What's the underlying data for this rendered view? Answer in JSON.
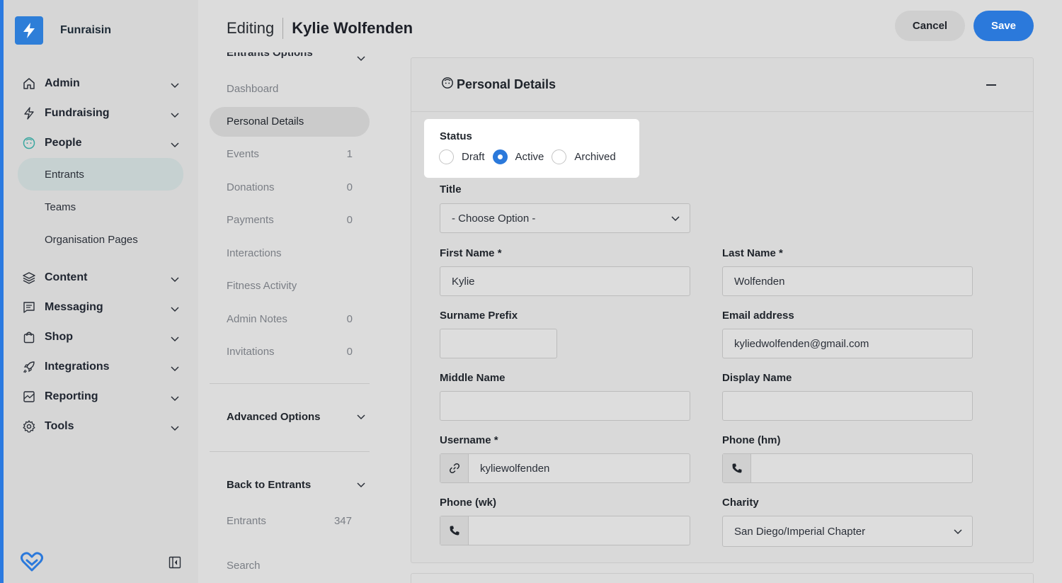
{
  "brand": {
    "name": "Funraisin"
  },
  "nav": {
    "items": [
      {
        "label": "Admin",
        "icon": "home-icon"
      },
      {
        "label": "Fundraising",
        "icon": "bolt-icon"
      },
      {
        "label": "People",
        "icon": "face-icon"
      },
      {
        "label": "Content",
        "icon": "layers-icon"
      },
      {
        "label": "Messaging",
        "icon": "message-icon"
      },
      {
        "label": "Shop",
        "icon": "bag-icon"
      },
      {
        "label": "Integrations",
        "icon": "rocket-icon"
      },
      {
        "label": "Reporting",
        "icon": "chart-icon"
      },
      {
        "label": "Tools",
        "icon": "gear-icon"
      }
    ],
    "people_sub": [
      "Entrants",
      "Teams",
      "Organisation Pages"
    ]
  },
  "header": {
    "prefix": "Editing",
    "name": "Kylie Wolfenden",
    "cancel_label": "Cancel",
    "save_label": "Save"
  },
  "mid": {
    "heading": "Entrants Options",
    "items": [
      {
        "label": "Dashboard",
        "count": ""
      },
      {
        "label": "Personal Details",
        "count": ""
      },
      {
        "label": "Events",
        "count": "1"
      },
      {
        "label": "Donations",
        "count": "0"
      },
      {
        "label": "Payments",
        "count": "0"
      },
      {
        "label": "Interactions",
        "count": ""
      },
      {
        "label": "Fitness Activity",
        "count": ""
      },
      {
        "label": "Admin Notes",
        "count": "0"
      },
      {
        "label": "Invitations",
        "count": "0"
      }
    ],
    "advanced": "Advanced Options",
    "back": "Back to Entrants",
    "entrants_label": "Entrants",
    "entrants_count": "347",
    "search_label": "Search"
  },
  "card": {
    "title": "Personal Details",
    "status": {
      "label": "Status",
      "options": [
        "Draft",
        "Active",
        "Archived"
      ],
      "selected": "Active"
    },
    "fields": {
      "title_label": "Title",
      "title_value": "- Choose Option -",
      "first_name_label": "First Name *",
      "first_name_value": "Kylie",
      "last_name_label": "Last Name *",
      "last_name_value": "Wolfenden",
      "surname_prefix_label": "Surname Prefix",
      "surname_prefix_value": "",
      "email_label": "Email address",
      "email_value": "kyliedwolfenden@gmail.com",
      "middle_name_label": "Middle Name",
      "middle_name_value": "",
      "display_name_label": "Display Name",
      "display_name_value": "",
      "username_label": "Username *",
      "username_value": "kyliewolfenden",
      "phone_hm_label": "Phone (hm)",
      "phone_hm_value": "",
      "phone_wk_label": "Phone (wk)",
      "phone_wk_value": "",
      "charity_label": "Charity",
      "charity_value": "San Diego/Imperial Chapter"
    }
  },
  "colors": {
    "accent": "#2b79db",
    "sidebar_active": "#c6d1d1"
  }
}
